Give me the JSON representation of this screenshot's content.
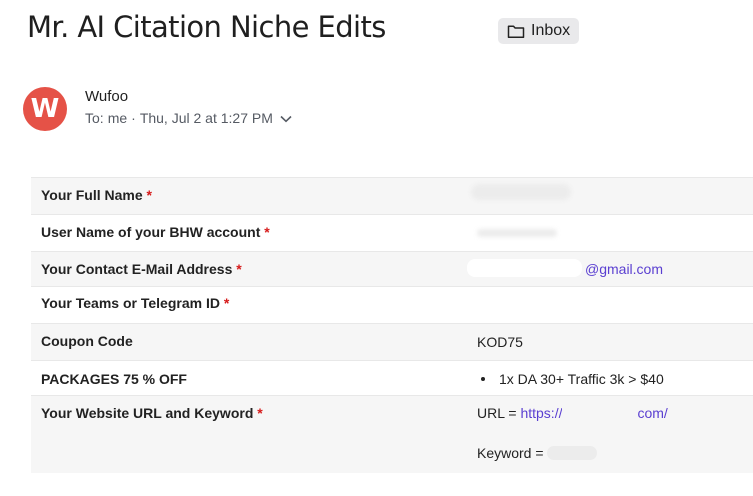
{
  "header": {
    "subject": "Mr. AI Citation Niche Edits",
    "folder_label": "Inbox"
  },
  "message": {
    "avatar_letter": "W",
    "sender": "Wufoo",
    "to_label": "To:",
    "to_value": "me",
    "date": "Thu, Jul 2 at 1:27 PM"
  },
  "form": {
    "rows": [
      {
        "label": "Your Full Name",
        "required": "*",
        "value": ""
      },
      {
        "label": "User Name of your BHW account",
        "required": "*",
        "value": ""
      },
      {
        "label": "Your Contact E-Mail Address",
        "required": "*",
        "value": "@gmail.com"
      },
      {
        "label": "Your Teams or Telegram ID",
        "required": "*",
        "value": ""
      },
      {
        "label": "Coupon Code",
        "required": "",
        "value": "KOD75"
      },
      {
        "label": "PACKAGES 75 % OFF",
        "required": "",
        "value": "1x DA 30+ Traffic 3k > $40"
      },
      {
        "label": "Your Website URL and Keyword",
        "required": "*",
        "url_prefix": "URL =",
        "url_start": "https://",
        "url_end": "com/",
        "keyword_prefix": "Keyword ="
      }
    ]
  },
  "colors": {
    "avatar": "#e55247",
    "link": "#5a3fd1",
    "required": "#d61a1a"
  }
}
